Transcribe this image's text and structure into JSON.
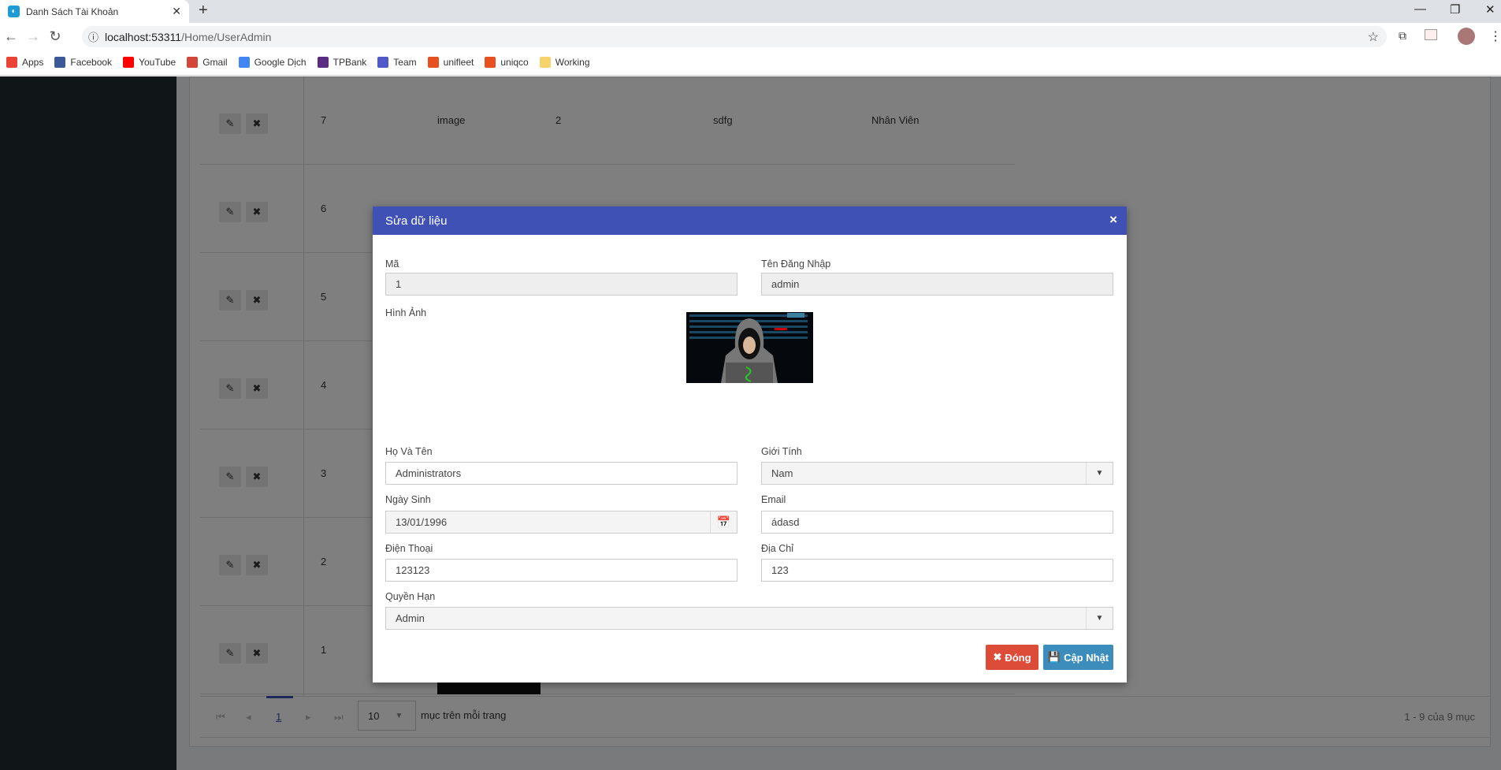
{
  "browser": {
    "tab_title": "Danh Sách Tài Khoản",
    "url_host": "localhost:53311",
    "url_path": "/Home/UserAdmin",
    "bookmarks": [
      {
        "label": "Apps",
        "color": "#ea4335"
      },
      {
        "label": "Facebook",
        "color": "#3b5998"
      },
      {
        "label": "YouTube",
        "color": "#ff0000"
      },
      {
        "label": "Gmail",
        "color": "#d44638"
      },
      {
        "label": "Google Dịch",
        "color": "#4285f4"
      },
      {
        "label": "TPBank",
        "color": "#5b2c83"
      },
      {
        "label": "Team",
        "color": "#5059c9"
      },
      {
        "label": "unifleet",
        "color": "#e8501f"
      },
      {
        "label": "uniqco",
        "color": "#e8501f"
      },
      {
        "label": "Working",
        "color": "#f6d36b"
      }
    ]
  },
  "table": {
    "rows": [
      {
        "id": "7",
        "image": "image",
        "c3": "2",
        "c4": "sdfg",
        "c5": "Nhân Viên"
      },
      {
        "id": "6"
      },
      {
        "id": "5"
      },
      {
        "id": "4"
      },
      {
        "id": "3"
      },
      {
        "id": "2"
      },
      {
        "id": "1"
      }
    ]
  },
  "pager": {
    "page": "1",
    "page_size": "10",
    "per_page_label": "mục trên mỗi trang",
    "summary": "1 - 9 của 9 mục"
  },
  "modal": {
    "title": "Sửa dữ liệu",
    "close": "×",
    "fields": {
      "ma": {
        "label": "Mã",
        "value": "1"
      },
      "username": {
        "label": "Tên Đăng Nhập",
        "value": "admin"
      },
      "image": {
        "label": "Hình Ảnh"
      },
      "fullname": {
        "label": "Họ Và Tên",
        "value": "Administrators"
      },
      "gender": {
        "label": "Giới Tính",
        "value": "Nam"
      },
      "dob": {
        "label": "Ngày Sinh",
        "value": "13/01/1996"
      },
      "email": {
        "label": "Email",
        "value": "ádasd"
      },
      "phone": {
        "label": "Điện Thoại",
        "value": "123123"
      },
      "address": {
        "label": "Địa Chỉ",
        "value": "123"
      },
      "role": {
        "label": "Quyền Hạn",
        "value": "Admin"
      }
    },
    "close_button": "Đóng",
    "update_button": "Cập Nhật",
    "colors": {
      "header": "#3f51b5",
      "close_btn": "#dd4b39",
      "update_btn": "#3c8dbc"
    }
  }
}
